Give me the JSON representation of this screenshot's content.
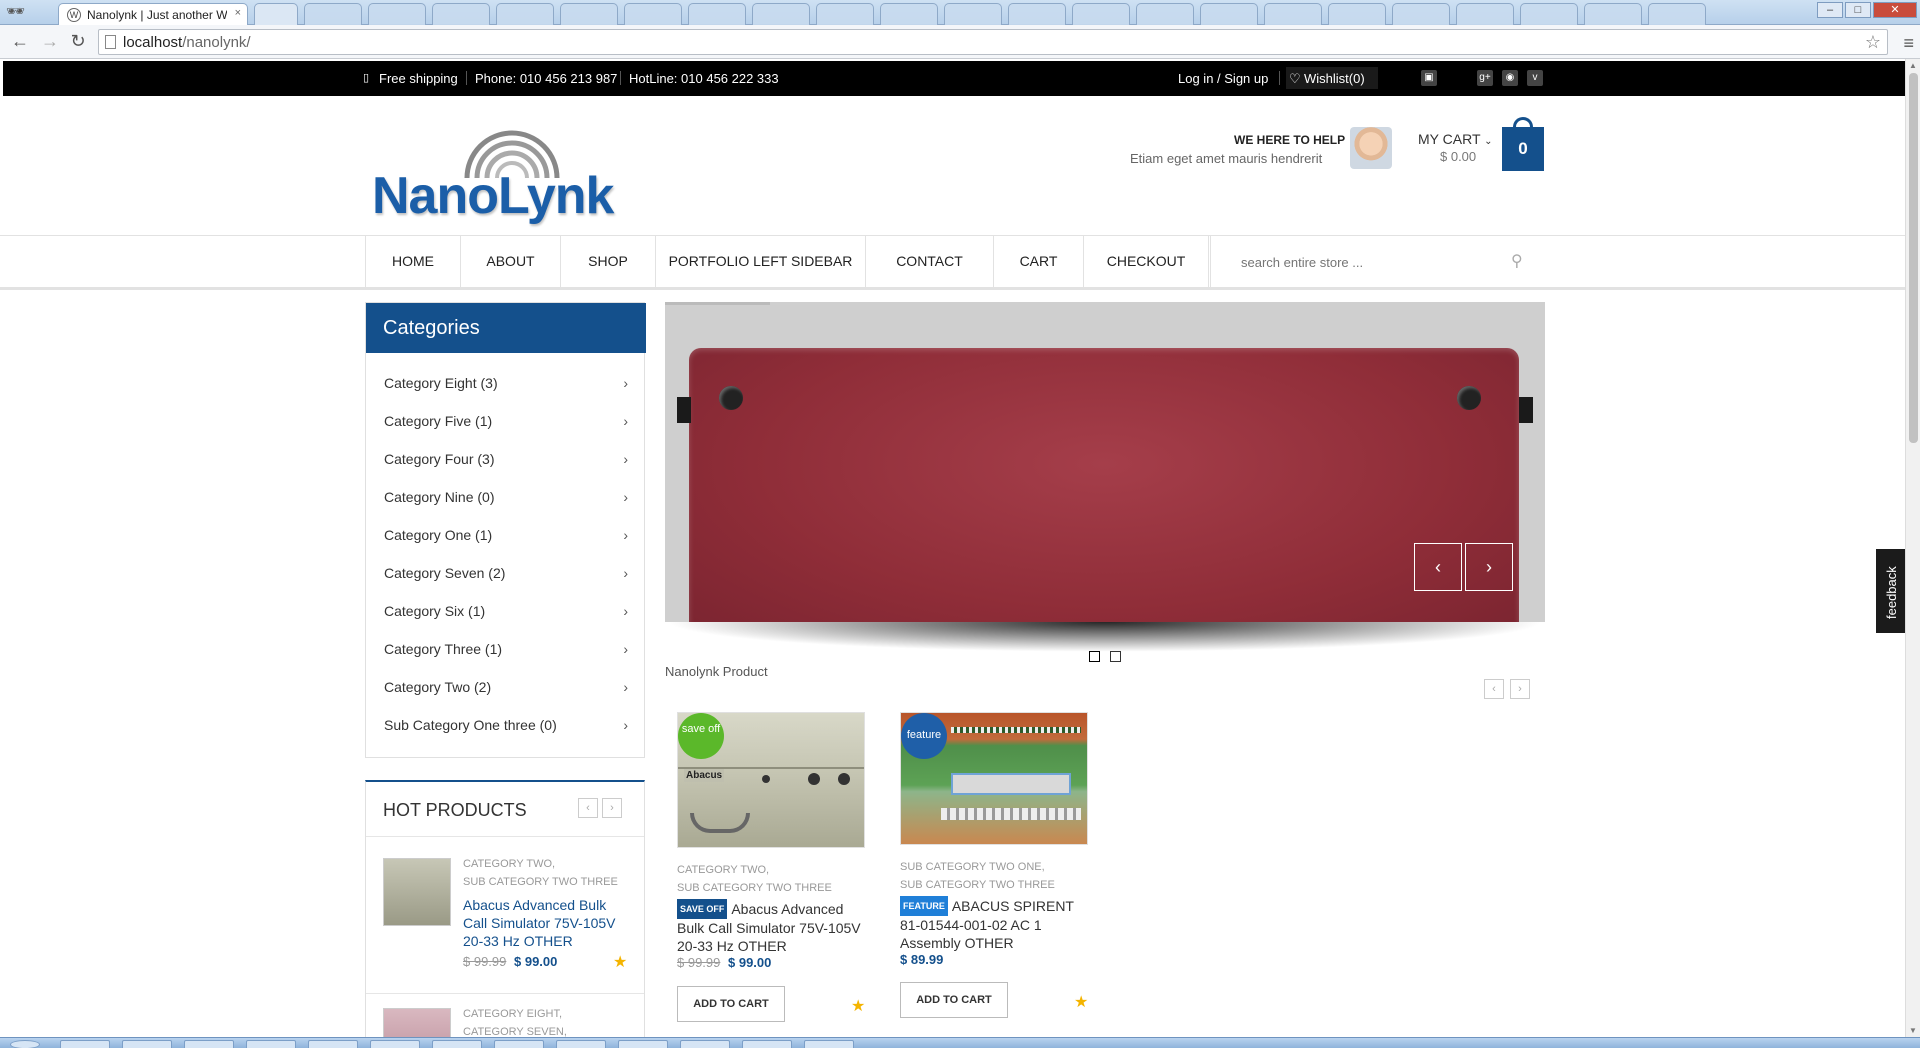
{
  "browser": {
    "active_tab_title": "Nanolynk | Just another W",
    "tab_close": "×",
    "url_host": "localhost",
    "url_path": "/nanolynk/",
    "back_icon": "←",
    "forward_icon": "→",
    "reload_icon": "↻",
    "star_icon": "☆",
    "menu_icon": "≡",
    "win_min": "–",
    "win_max": "□",
    "win_close": "✕"
  },
  "topbar": {
    "free_shipping": "Free shipping",
    "phone": "Phone: 010 456 213 987",
    "hotline": "HotLine: 010 456 222 333",
    "login": "Log in / Sign up",
    "wishlist": "Wishlist(0)",
    "social": [
      "▣",
      "g+",
      "◉",
      "v"
    ]
  },
  "header": {
    "logo_text": "NanoLynk",
    "help_title": "WE HERE TO HELP",
    "help_sub": "Etiam eget amet mauris hendrerit",
    "cart_title": "MY CART",
    "cart_total": "$ 0.00",
    "cart_count": "0"
  },
  "nav": {
    "items": [
      "HOME",
      "ABOUT",
      "SHOP",
      "PORTFOLIO LEFT SIDEBAR",
      "CONTACT",
      "CART",
      "CHECKOUT"
    ],
    "search_placeholder": "search entire store ..."
  },
  "categories": {
    "title": "Categories",
    "items": [
      "Category Eight (3)",
      "Category Five (1)",
      "Category Four (3)",
      "Category Nine (0)",
      "Category One (1)",
      "Category Seven (2)",
      "Category Six (1)",
      "Category Three (1)",
      "Category Two (2)",
      "Sub Category One three (0)"
    ]
  },
  "hot_products": {
    "title": "HOT PRODUCTS",
    "items": [
      {
        "cat1": "CATEGORY TWO,",
        "cat2": "SUB CATEGORY TWO THREE",
        "title": "Abacus Advanced Bulk Call Simulator 75V-105V 20-33 Hz OTHER",
        "old_price": "$ 99.99",
        "price": "$ 99.00"
      },
      {
        "cat1": "CATEGORY EIGHT,",
        "cat2": "CATEGORY SEVEN,"
      }
    ]
  },
  "slider": {
    "prev": "‹",
    "next": "›"
  },
  "products": {
    "section_title": "Nanolynk Product",
    "items": [
      {
        "badge": "save off",
        "cat1": "CATEGORY TWO,",
        "cat2": "SUB CATEGORY TWO THREE",
        "tag": "SAVE OFF",
        "title": "Abacus Advanced Bulk Call Simulator 75V-105V 20-33 Hz OTHER",
        "old_price": "$ 99.99",
        "price": "$ 99.00",
        "button": "ADD TO CART",
        "img_label": "Abacus"
      },
      {
        "badge": "feature",
        "cat1": "SUB CATEGORY TWO ONE,",
        "cat2": "SUB CATEGORY TWO THREE",
        "tag": "FEATURE",
        "title": "ABACUS SPIRENT 81-01544-001-02 AC 1 Assembly OTHER",
        "price": "$ 89.99",
        "button": "ADD TO CART"
      }
    ]
  },
  "feedback": "feedback",
  "colors": {
    "brand_blue": "#14508c",
    "topbar_black": "#000000",
    "save_badge": "#5bb82a",
    "feature_badge": "#1f5fa8",
    "star": "#f4b400"
  }
}
